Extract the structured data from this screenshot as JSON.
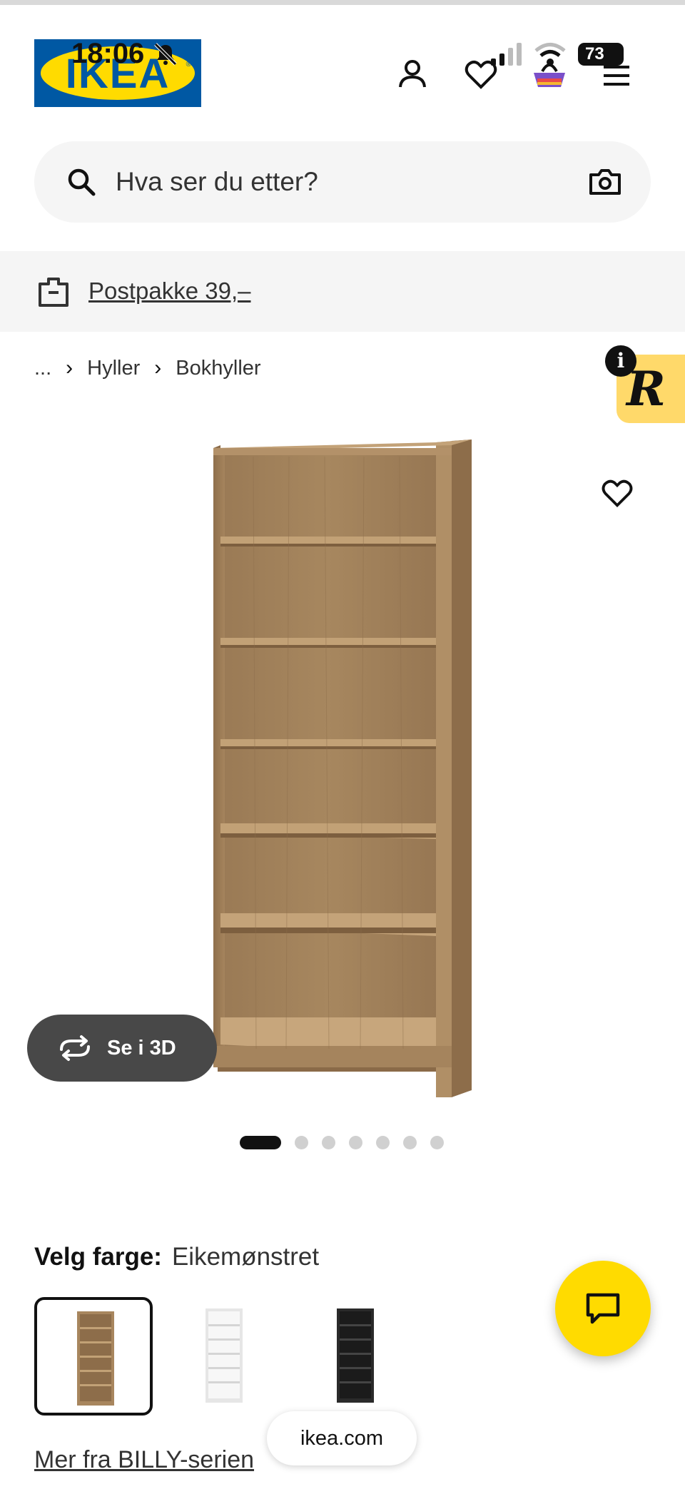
{
  "status_bar": {
    "time": "18:06",
    "battery": "73",
    "icons": [
      "bell-muted-icon",
      "signal-icon",
      "wifi-icon",
      "battery-icon"
    ]
  },
  "header": {
    "logo_text": "IKEA",
    "icons": [
      "user-icon",
      "heart-icon",
      "shopping-bag-icon",
      "menu-icon"
    ]
  },
  "search": {
    "placeholder": "Hva ser du etter?",
    "icons": [
      "search-icon",
      "camera-icon"
    ]
  },
  "delivery_banner": {
    "text": "Postpakke 39,–",
    "icon": "parcel-icon"
  },
  "breadcrumb": {
    "items": [
      "...",
      "Hyller",
      "Bokhyller"
    ]
  },
  "product": {
    "image_alt": "Bookcase in oak effect",
    "view_3d_label": "Se i 3D",
    "gallery_count": 7,
    "gallery_active": 1
  },
  "color": {
    "label": "Velg farge:",
    "selected": "Eikemønstret",
    "options": [
      "oak",
      "white",
      "black"
    ]
  },
  "series_link": "Mer fra BILLY-serien",
  "browser": {
    "url": "ikea.com"
  },
  "colors": {
    "brand_blue": "#0058a3",
    "brand_yellow": "#ffdb00",
    "badge_yellow": "#ffd96a",
    "oak": "#a8865e",
    "white_shelf": "#f2f2f2",
    "black_shelf": "#2a2a2a"
  }
}
